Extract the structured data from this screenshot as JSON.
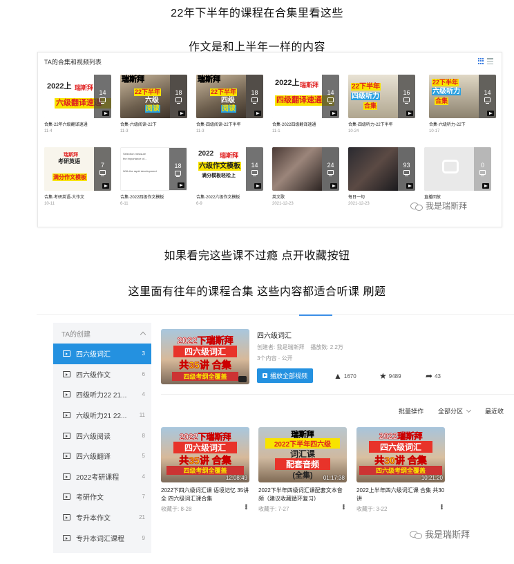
{
  "captions": {
    "c1": "22年下半年的课程在合集里看这些",
    "c2": "作文是和上半年一样的内容",
    "c3": "如果看完这些课不过瘾 点开收藏按钮",
    "c4": "这里面有往年的课程合集 这些内容都适合听课 刷题"
  },
  "panel1": {
    "title": "TA的合集和视频列表",
    "cards": [
      {
        "title": "合集·22年六级翻译速通",
        "date": "11-4",
        "count": "14",
        "art": [
          "2022上",
          "瑞斯拜",
          "六级翻译速通"
        ]
      },
      {
        "title": "合集·六级阅读-22下",
        "date": "11-3",
        "count": "18",
        "art": [
          "瑞斯拜",
          "22下半年",
          "六级",
          "阅读"
        ]
      },
      {
        "title": "合集·四级阅读-22下半年",
        "date": "11-3",
        "count": "18",
        "art": [
          "瑞斯拜",
          "22下半年",
          "四级",
          "阅读"
        ]
      },
      {
        "title": "合集·2022四级翻译速通",
        "date": "11-1",
        "count": "14",
        "art": [
          "2022上",
          "瑞斯拜",
          "四级翻译速通"
        ]
      },
      {
        "title": "合集·四级听力-22下半年",
        "date": "10-24",
        "count": "16",
        "art": [
          "22下半年",
          "四级听力",
          "合集"
        ]
      },
      {
        "title": "合集·六级听力-22下",
        "date": "10-17",
        "count": "14",
        "art": [
          "22下半年",
          "六级听力",
          "合集"
        ]
      },
      {
        "title": "合集·考研英语-大作文",
        "date": "10-11",
        "count": "7",
        "art": [
          "瑞斯拜",
          "考研英语",
          "满分作文模板"
        ]
      },
      {
        "title": "合集·2022四级作文模板",
        "date": "6-11",
        "count": "18",
        "art": [
          "Selection measure",
          "the importance of…",
          "With the rapid development"
        ]
      },
      {
        "title": "合集·2022六级作文模板",
        "date": "6-9",
        "count": "14",
        "art": [
          "2022",
          "瑞斯拜",
          "六级作文模板",
          "满分模板轻松上"
        ]
      },
      {
        "title": "英文歌",
        "date": "2021-12-23",
        "count": "24",
        "art": []
      },
      {
        "title": "每日一句",
        "date": "2021-12-23",
        "count": "93",
        "art": []
      },
      {
        "title": "直播回放",
        "date": "",
        "count": "0",
        "art": []
      }
    ]
  },
  "watermark": "我是瑞斯拜",
  "panel2": {
    "sidebar": {
      "header": "TA的创建",
      "items": [
        {
          "label": "四六级词汇",
          "count": "3"
        },
        {
          "label": "四六级作文",
          "count": "6"
        },
        {
          "label": "四级听力22 21...",
          "count": "4"
        },
        {
          "label": "六级听力21 22...",
          "count": "11"
        },
        {
          "label": "四六级阅读",
          "count": "8"
        },
        {
          "label": "四六级翻译",
          "count": "5"
        },
        {
          "label": "2022考研课程",
          "count": "4"
        },
        {
          "label": "考研作文",
          "count": "7"
        },
        {
          "label": "专升本作文",
          "count": "21"
        },
        {
          "label": "专升本词汇课程",
          "count": "9"
        }
      ]
    },
    "feature": {
      "title": "四六级词汇",
      "creator": "创建者: 我是瑞斯拜",
      "plays": "播放数: 2.2万",
      "count": "3个内容",
      "visibility": "公开",
      "play_all": "播放全部视频",
      "likes": "1670",
      "favs": "9489",
      "shares": "43",
      "art": [
        "2022下瑞斯拜",
        "四六级词汇",
        "共35讲 合集",
        "四级考纲全覆盖"
      ]
    },
    "ops": {
      "batch": "批量操作",
      "all_zones": "全部分区",
      "recent": "最近收"
    },
    "videos": [
      {
        "title": "2022下四六级词汇课 语境记忆 35讲 全 四六级词汇课合集",
        "meta": "收藏于: 8-28",
        "duration": "12:08:49",
        "art": [
          "2022下瑞斯拜",
          "四六级词汇",
          "共35讲 合集",
          "四级考纲全覆盖"
        ]
      },
      {
        "title": "2022下半年四级词汇课配套文本音频（建议收藏循环复习）",
        "meta": "收藏于: 7-27",
        "duration": "01:17:38",
        "art": [
          "瑞斯拜",
          "2022下半年四六级",
          "词汇课",
          "配套音频",
          "(全集)"
        ]
      },
      {
        "title": "2022上半年四六级词汇课 合集 共30讲",
        "meta": "收藏于: 3-22",
        "duration": "10:21:20",
        "art": [
          "2022瑞斯拜",
          "四六级词汇",
          "共30讲 合集",
          "四六级考纲全覆盖"
        ]
      }
    ]
  },
  "colors": {
    "accent": "#2491e0",
    "yellow": "#f8e300",
    "red": "#e02020"
  }
}
